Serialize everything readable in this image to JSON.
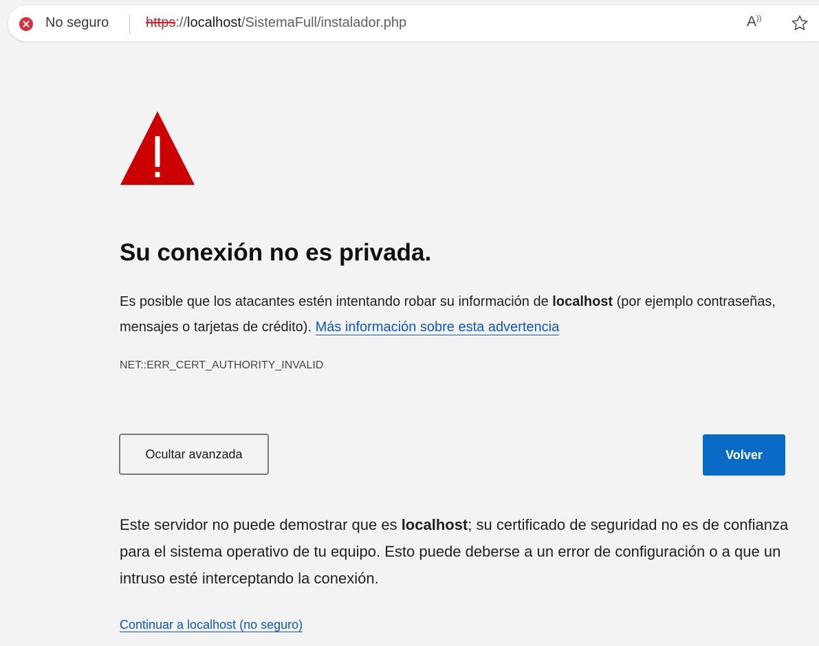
{
  "address_bar": {
    "security_label": "No seguro",
    "url_scheme": "https",
    "url_scheme_sep": "://",
    "url_host": "localhost",
    "url_path": "/SistemaFull/instalador.php",
    "read_aloud_icon": "A",
    "star_icon": "favorite-star-icon"
  },
  "page": {
    "title": "Su conexión no es privada.",
    "desc_text_1": "Es posible que los atacantes estén intentando robar su información de ",
    "desc_host": "localhost",
    "desc_text_2": " (por ejemplo contraseñas, mensajes o tarjetas de crédito). ",
    "learn_more_link": "Más información sobre esta advertencia",
    "error_code": "NET::ERR_CERT_AUTHORITY_INVALID",
    "hide_advanced_button": "Ocultar avanzada",
    "back_button": "Volver",
    "details_text_1": "Este servidor no puede demostrar que es ",
    "details_host": "localhost",
    "details_text_2": "; su certificado de seguridad no es de confianza para el sistema operativo de tu equipo. Esto puede deberse a un error de configuración o a que un intruso esté interceptando la conexión.",
    "proceed_link": "Continuar a localhost (no seguro)"
  },
  "colors": {
    "warning_red": "#cc0000",
    "link_blue": "#0b57c9",
    "primary_button": "#0a6bc6",
    "background": "#f3f3f3"
  }
}
